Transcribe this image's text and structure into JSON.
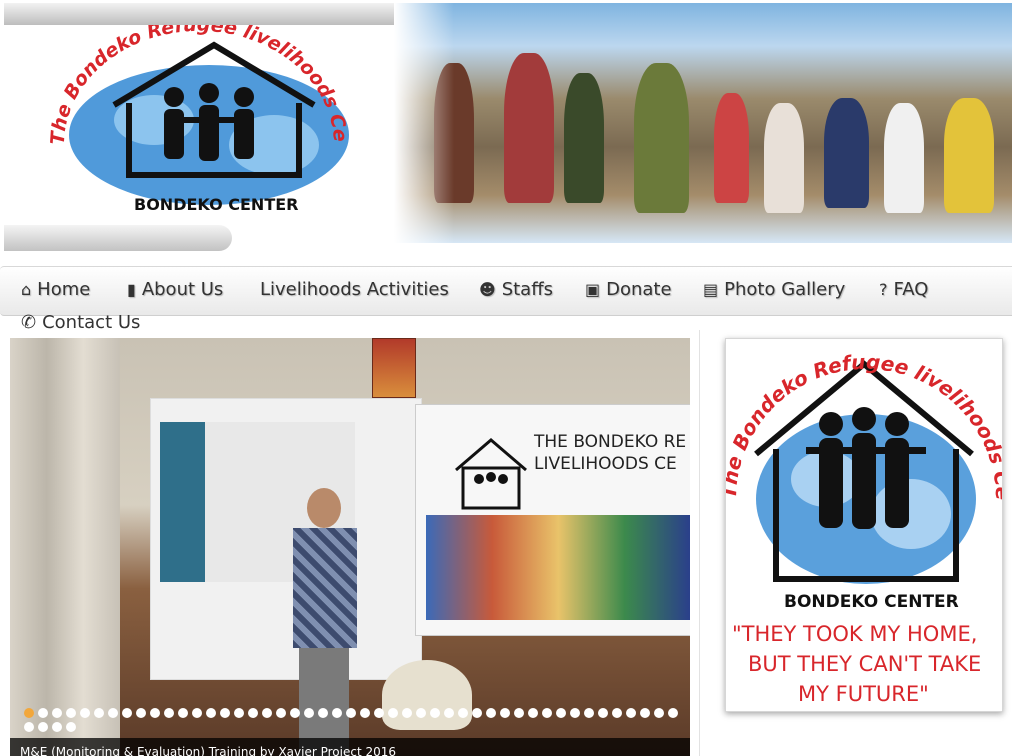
{
  "header": {
    "logo": {
      "arc_text": "The Bondeko Refugee livelihoods Center",
      "center_text": "BONDEKO CENTER"
    },
    "banner_image": "crowd-of-refugees-walking-photo"
  },
  "nav": {
    "items": [
      {
        "icon": "home-icon",
        "glyph": "⌂",
        "label": "Home"
      },
      {
        "icon": "book-icon",
        "glyph": "▮",
        "label": "About Us"
      },
      {
        "icon": "",
        "glyph": "",
        "label": "Livelihoods Activities"
      },
      {
        "icon": "users-icon",
        "glyph": "☻",
        "label": "Staffs"
      },
      {
        "icon": "gift-icon",
        "glyph": "▣",
        "label": "Donate"
      },
      {
        "icon": "picture-icon",
        "glyph": "▤",
        "label": "Photo Gallery"
      },
      {
        "icon": "question-icon",
        "glyph": "?",
        "label": "FAQ"
      }
    ],
    "contact": {
      "icon": "phone-icon",
      "glyph": "✆",
      "label": "Contact Us"
    }
  },
  "slider": {
    "banner_title_line1": "THE BONDEKO RE",
    "banner_title_line2": "LIVELIHOODS CE",
    "caption": "M&E (Monitoring & Evaluation) Training by Xavier Project 2016",
    "dot_count": 51,
    "active_index": 0
  },
  "sidebar": {
    "logo_arc_text": "The Bondeko Refugee livelihoods Center",
    "logo_center_text": "BONDEKO CENTER",
    "quote_line1": "\"THEY TOOK MY HOME,",
    "quote_line2": "BUT THEY CAN'T TAKE",
    "quote_line3": "MY FUTURE\""
  },
  "colors": {
    "brand_red": "#d8262b",
    "map_blue": "#3d8fd6",
    "active_dot": "#f2a73b"
  }
}
